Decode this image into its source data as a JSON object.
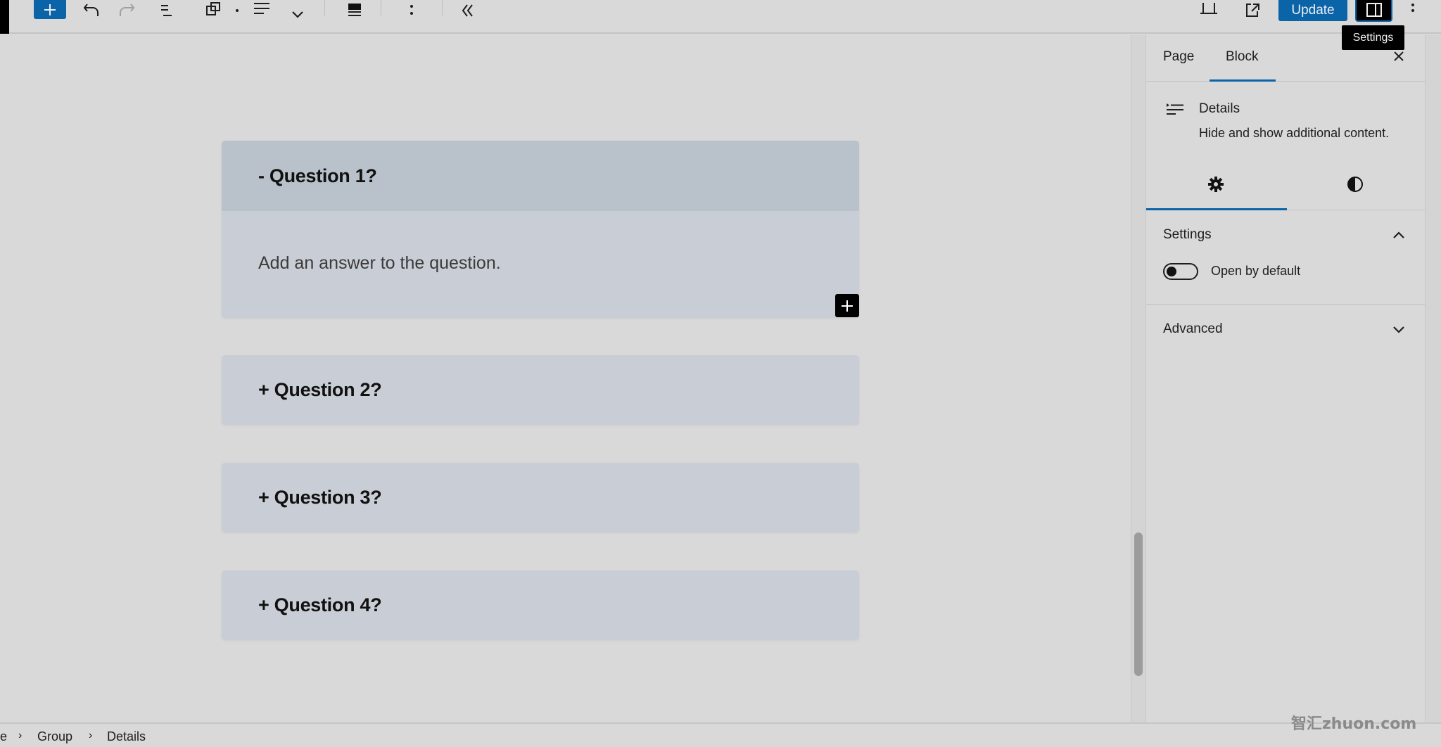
{
  "toolbar": {
    "inserter": "add-block",
    "undo": "undo",
    "redo": "redo",
    "list_view": "document-overview",
    "block_type": "details-block",
    "align": "align",
    "more_chevron": "chevron-down",
    "full_width": "full-width",
    "options": "options",
    "collapse": "collapse-toolbar",
    "update_label": "Update",
    "tooltip": "Settings"
  },
  "canvas": {
    "items": [
      {
        "summary": "- Question 1?",
        "open": true,
        "answer": "Add an answer to the question."
      },
      {
        "summary": "+ Question 2?",
        "open": false
      },
      {
        "summary": "+ Question 3?",
        "open": false
      },
      {
        "summary": "+ Question 4?",
        "open": false
      }
    ]
  },
  "sidebar": {
    "tabs": [
      "Page",
      "Block"
    ],
    "active_tab": "Block",
    "block": {
      "title": "Details",
      "description": "Hide and show additional content."
    },
    "settings_panel": {
      "title": "Settings",
      "toggle_label": "Open by default",
      "toggle_on": false
    },
    "advanced_panel": {
      "title": "Advanced"
    }
  },
  "footer": {
    "breadcrumb": [
      "e",
      "Group",
      "Details"
    ]
  },
  "watermark": "智汇zhuon.com",
  "colors": {
    "accent": "#0b63a8",
    "background": "#d9d9d9",
    "card_header": "#b9c1ca",
    "card_body": "#c9cdd5"
  }
}
